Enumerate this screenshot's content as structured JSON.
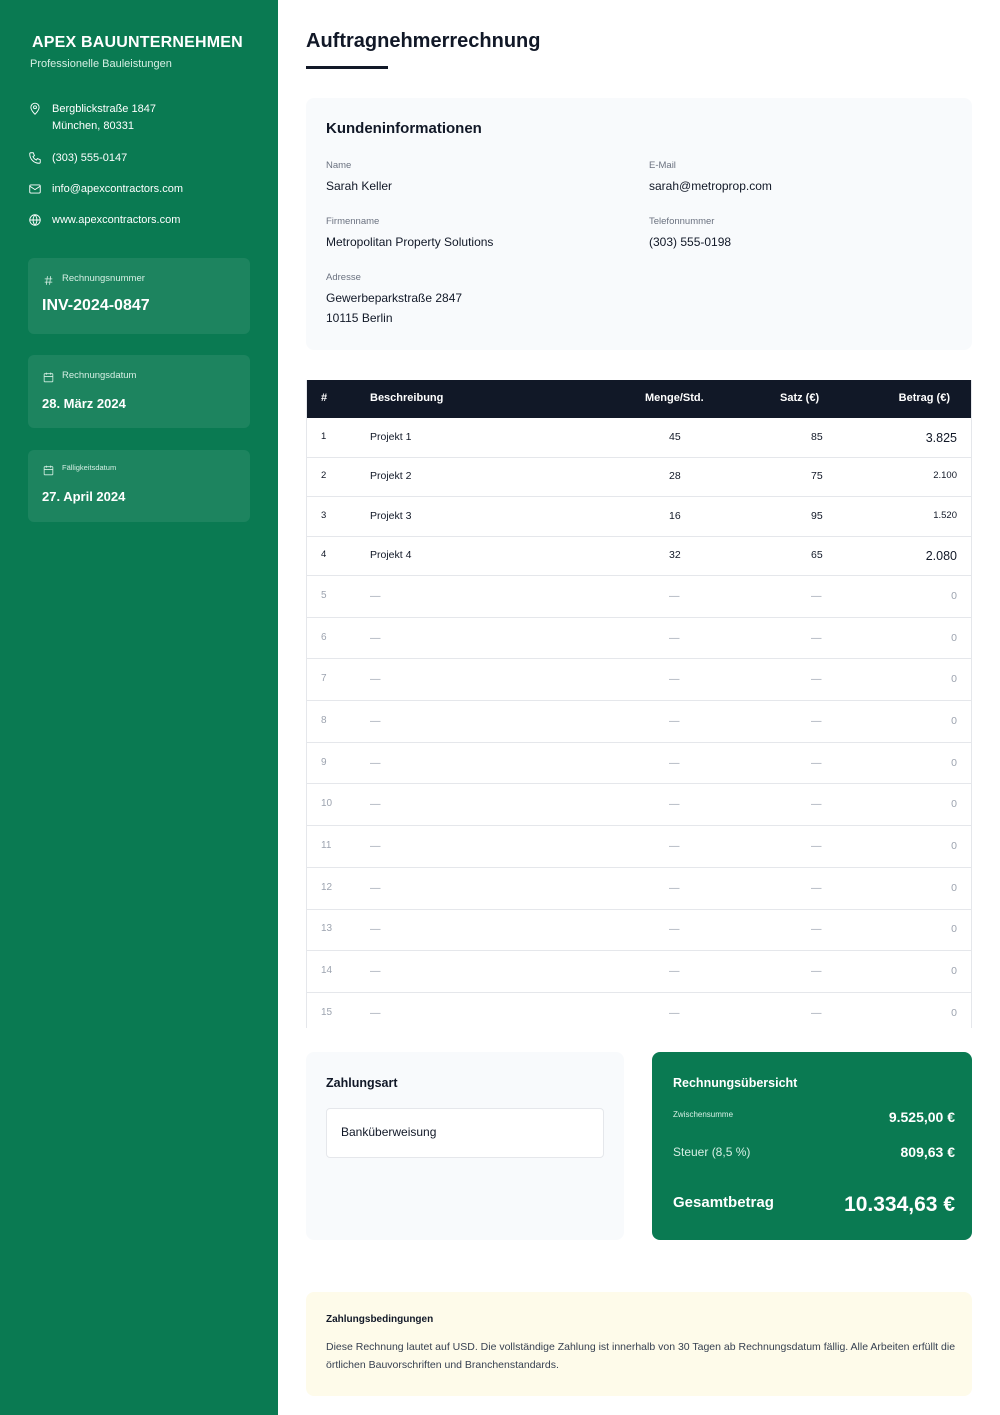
{
  "company": {
    "name": "APEX BAUUNTERNEHMEN",
    "tagline": "Professionelle Bauleistungen",
    "address_line1": "Bergblickstraße 1847",
    "address_line2": "München, 80331",
    "phone": "(303) 555-0147",
    "email": "info@apexcontractors.com",
    "website": "www.apexcontractors.com"
  },
  "invoice": {
    "number_label": "Rechnungsnummer",
    "number": "INV-2024-0847",
    "date_label": "Rechnungsdatum",
    "date": "28. März 2024",
    "due_label": "Fälligkeitsdatum",
    "due": "27. April 2024"
  },
  "title": "Auftragnehmerrechnung",
  "client": {
    "heading": "Kundeninformationen",
    "name_label": "Name",
    "name": "Sarah Keller",
    "email_label": "E-Mail",
    "email": "sarah@metroprop.com",
    "company_label": "Firmenname",
    "company": "Metropolitan Property Solutions",
    "phone_label": "Telefonnummer",
    "phone": "(303) 555-0198",
    "address_label": "Adresse",
    "address_line1": "Gewerbeparkstraße 2847",
    "address_line2": "10115 Berlin"
  },
  "table": {
    "headers": [
      "#",
      "Beschreibung",
      "Menge/Std.",
      "Satz (€)",
      "Betrag (€)"
    ],
    "rows": [
      {
        "n": "1",
        "desc": "Projekt 1",
        "qty": "45",
        "rate": "85",
        "amount": "3.825"
      },
      {
        "n": "2",
        "desc": "Projekt 2",
        "qty": "28",
        "rate": "75",
        "amount": "2.100"
      },
      {
        "n": "3",
        "desc": "Projekt 3",
        "qty": "16",
        "rate": "95",
        "amount": "1.520"
      },
      {
        "n": "4",
        "desc": "Projekt 4",
        "qty": "32",
        "rate": "65",
        "amount": "2.080"
      },
      {
        "n": "5",
        "desc": "—",
        "qty": "—",
        "rate": "—",
        "amount": "0"
      },
      {
        "n": "6",
        "desc": "—",
        "qty": "—",
        "rate": "—",
        "amount": "0"
      },
      {
        "n": "7",
        "desc": "—",
        "qty": "—",
        "rate": "—",
        "amount": "0"
      },
      {
        "n": "8",
        "desc": "—",
        "qty": "—",
        "rate": "—",
        "amount": "0"
      },
      {
        "n": "9",
        "desc": "—",
        "qty": "—",
        "rate": "—",
        "amount": "0"
      },
      {
        "n": "10",
        "desc": "—",
        "qty": "—",
        "rate": "—",
        "amount": "0"
      },
      {
        "n": "11",
        "desc": "—",
        "qty": "—",
        "rate": "—",
        "amount": "0"
      },
      {
        "n": "12",
        "desc": "—",
        "qty": "—",
        "rate": "—",
        "amount": "0"
      },
      {
        "n": "13",
        "desc": "—",
        "qty": "—",
        "rate": "—",
        "amount": "0"
      },
      {
        "n": "14",
        "desc": "—",
        "qty": "—",
        "rate": "—",
        "amount": "0"
      },
      {
        "n": "15",
        "desc": "—",
        "qty": "—",
        "rate": "—",
        "amount": "0"
      }
    ]
  },
  "payment": {
    "heading": "Zahlungsart",
    "method": "Banküberweisung"
  },
  "summary": {
    "heading": "Rechnungsübersicht",
    "subtotal_label": "Zwischensumme",
    "subtotal": "9.525,00 €",
    "tax_label": "Steuer (8,5 %)",
    "tax": "809,63 €",
    "total_label": "Gesamtbetrag",
    "total": "10.334,63 €"
  },
  "terms": {
    "heading": "Zahlungsbedingungen",
    "text": "Diese Rechnung lautet auf USD. Die vollständige Zahlung ist innerhalb von 30 Tagen ab Rechnungsdatum fällig. Alle Arbeiten erfüllt die örtlichen Bauvorschriften und Branchenstandards."
  },
  "colors": {
    "brand_green": "#0a7a52",
    "table_header": "#111827",
    "terms_bg": "#fefbea"
  }
}
